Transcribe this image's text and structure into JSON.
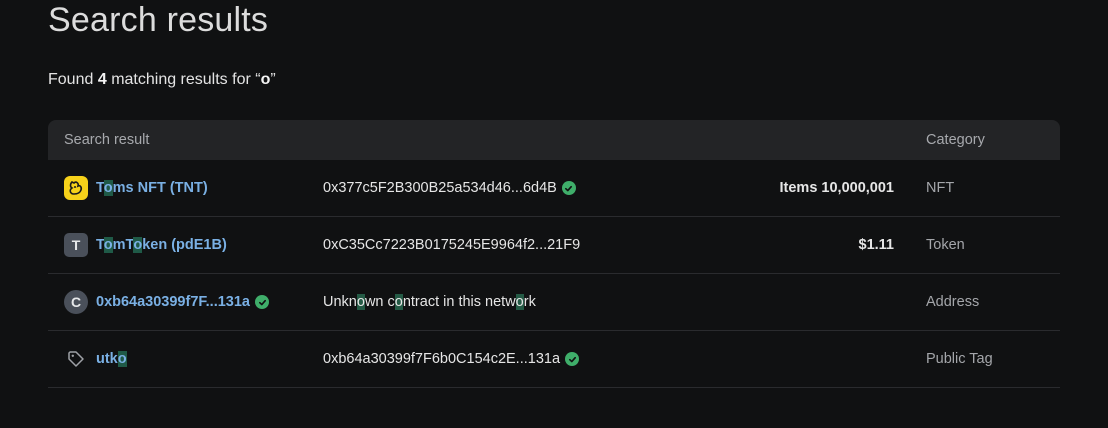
{
  "page": {
    "title": "Search results",
    "summary_prefix": "Found",
    "count": "4",
    "summary_mid": "matching results for",
    "query": "o"
  },
  "table": {
    "headers": {
      "result": "Search result",
      "category": "Category"
    },
    "rows": [
      {
        "icon": "nft-logo-icon",
        "name_parts": [
          "T",
          "o",
          "ms NFT (TNT)"
        ],
        "address": "0x377c5F2B300B25a534d46...6d4B",
        "verified": true,
        "value": "Items 10,000,001",
        "category": "NFT"
      },
      {
        "icon": "token-letter-icon",
        "icon_letter": "T",
        "name_parts": [
          "T",
          "o",
          "mT",
          "o",
          "ken (pdE1B)"
        ],
        "address": "0xC35Cc7223B0175245E9964f2...21F9",
        "verified": false,
        "value": "$1.11",
        "category": "Token"
      },
      {
        "icon": "contract-letter-icon",
        "icon_letter": "C",
        "name": "0xb64a30399f7F...131a",
        "verified": true,
        "desc_parts": [
          "Unkn",
          "o",
          "wn c",
          "o",
          "ntract in this netw",
          "o",
          "rk"
        ],
        "value": "",
        "category": "Address"
      },
      {
        "icon": "tag-icon",
        "name_parts": [
          "utk",
          "o"
        ],
        "address": "0xb64a30399f7F6b0C154c2E...131a",
        "verified": true,
        "value": "",
        "category": "Public Tag"
      }
    ]
  },
  "colors": {
    "background": "#101112",
    "link": "#7ab0e4",
    "highlight": "#1f5a47",
    "verified": "#3fae6a",
    "header_bg": "#232426"
  }
}
